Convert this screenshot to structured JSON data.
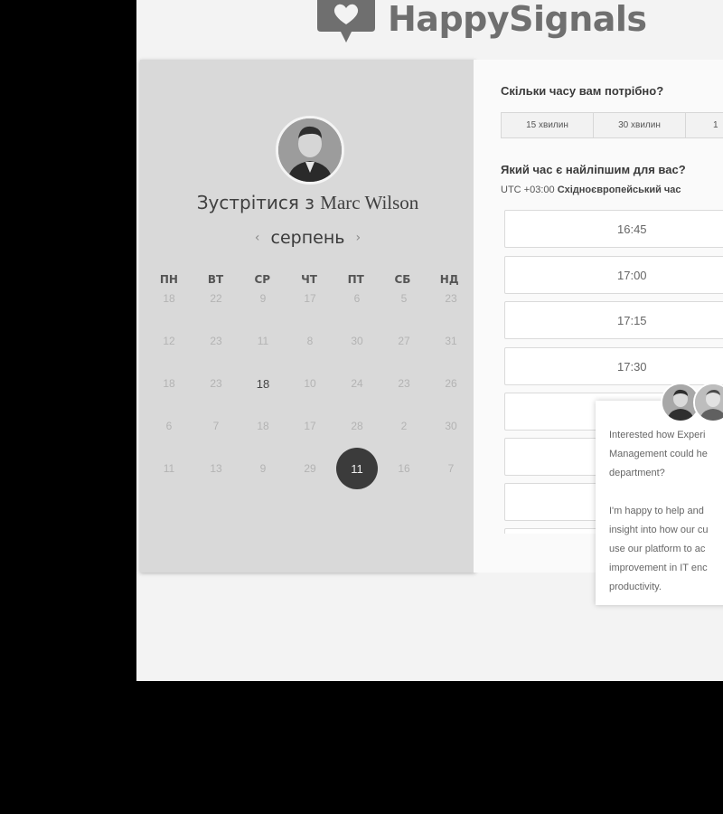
{
  "brand": {
    "name": "HappySignals"
  },
  "meeting": {
    "title_prefix": "Зустрітися з",
    "host_name": "Marc Wilson",
    "month": "серпень",
    "prev_icon": "chevron-left-icon",
    "next_icon": "chevron-right-icon"
  },
  "calendar": {
    "weekdays": [
      "ПН",
      "ВТ",
      "СР",
      "ЧТ",
      "ПТ",
      "СБ",
      "НД"
    ],
    "weeks": [
      [
        "18",
        "22",
        "9",
        "17",
        "6",
        "5",
        "23"
      ],
      [
        "12",
        "23",
        "11",
        "8",
        "30",
        "27",
        "31"
      ],
      [
        "18",
        "23",
        "18",
        "10",
        "24",
        "23",
        "26"
      ],
      [
        "6",
        "7",
        "18",
        "17",
        "28",
        "2",
        "30"
      ],
      [
        "11",
        "13",
        "9",
        "29",
        "11",
        "16",
        "7"
      ]
    ]
  },
  "booking": {
    "duration_question": "Скільки часу вам потрібно?",
    "durations": [
      "15 хвилин",
      "30 хвилин",
      "1"
    ],
    "time_question": "Який час є найліпшим для вас?",
    "timezone_offset": "UTC +03:00",
    "timezone_name": "Східноєвропейський час",
    "slots": [
      "16:45",
      "17:00",
      "17:15",
      "17:30",
      "",
      "",
      "",
      ""
    ]
  },
  "popup": {
    "paragraph1": [
      "Interested how Experi",
      "Management could he",
      "department?"
    ],
    "paragraph2": [
      "I'm happy to help and",
      "insight into how our cu",
      "use our platform to ac",
      "improvement in IT enc",
      "productivity."
    ]
  },
  "colors": {
    "page_bg": "#f3f3f3",
    "card_bg": "#d9d9d9",
    "selected_day": "#3b3b3b",
    "logo": "#6f6f6f"
  }
}
